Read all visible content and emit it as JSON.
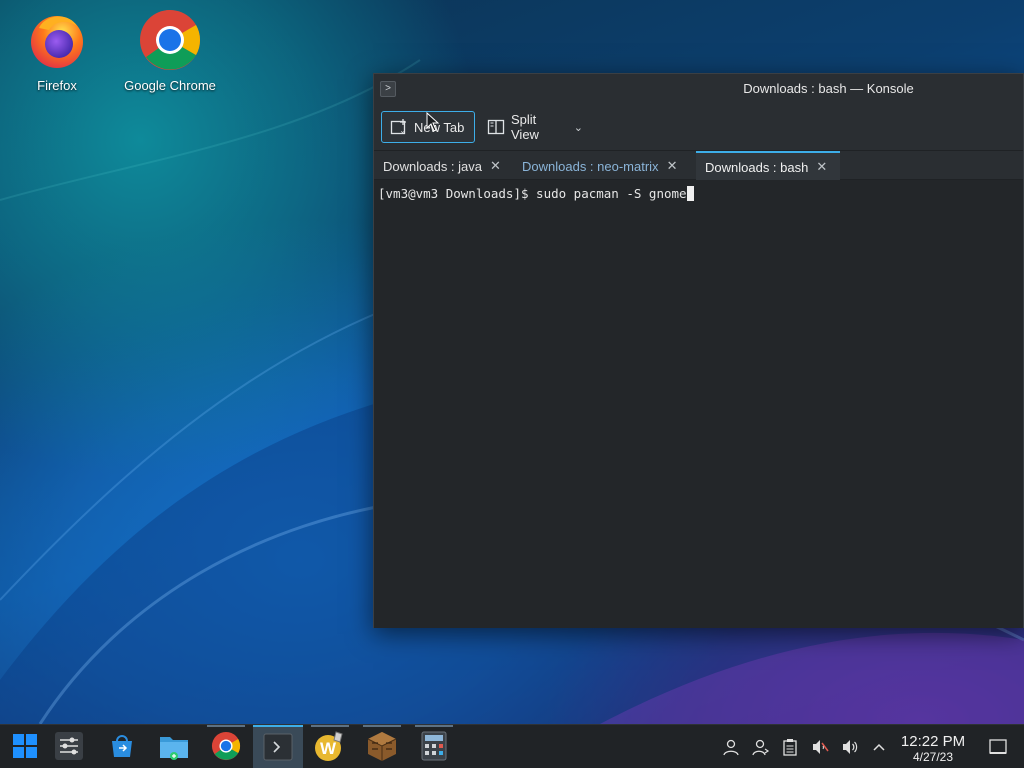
{
  "desktop": {
    "icons": [
      {
        "label": "Firefox",
        "icon": "firefox-icon"
      },
      {
        "label": "Google Chrome",
        "icon": "chrome-icon"
      }
    ]
  },
  "konsole": {
    "window_title": "Downloads : bash — Konsole",
    "toolbar": {
      "new_tab_label": "New Tab",
      "split_view_label": "Split View"
    },
    "tabs": [
      {
        "label": "Downloads : java",
        "active": false
      },
      {
        "label": "Downloads : neo-matrix",
        "active": false
      },
      {
        "label": "Downloads : bash",
        "active": true
      }
    ],
    "terminal": {
      "prompt": "[vm3@vm3 Downloads]$ ",
      "command": "sudo pacman -S gnome"
    }
  },
  "taskbar": {
    "apps": [
      {
        "name": "start-menu",
        "icon": "windows-start-icon"
      },
      {
        "name": "system-settings",
        "icon": "sliders-icon"
      },
      {
        "name": "discover-store",
        "icon": "store-bag-icon"
      },
      {
        "name": "file-manager",
        "icon": "folder-icon"
      },
      {
        "name": "google-chrome",
        "icon": "chrome-icon"
      },
      {
        "name": "konsole",
        "icon": "terminal-icon",
        "active": true
      },
      {
        "name": "word-game",
        "icon": "w-game-icon"
      },
      {
        "name": "minecraft",
        "icon": "crafting-table-icon"
      },
      {
        "name": "calculator",
        "icon": "calculator-icon"
      }
    ],
    "tray": [
      "user-icon",
      "user-switch-icon",
      "clipboard-icon",
      "speaker-muted-icon",
      "volume-icon",
      "chevron-up-icon"
    ],
    "clock": {
      "time": "12:22 PM",
      "date": "4/27/23"
    }
  },
  "colors": {
    "accent": "#3daee9",
    "window_bg": "#232629",
    "titlebar_bg": "#2a2e32",
    "taskbar_bg": "#202326"
  }
}
